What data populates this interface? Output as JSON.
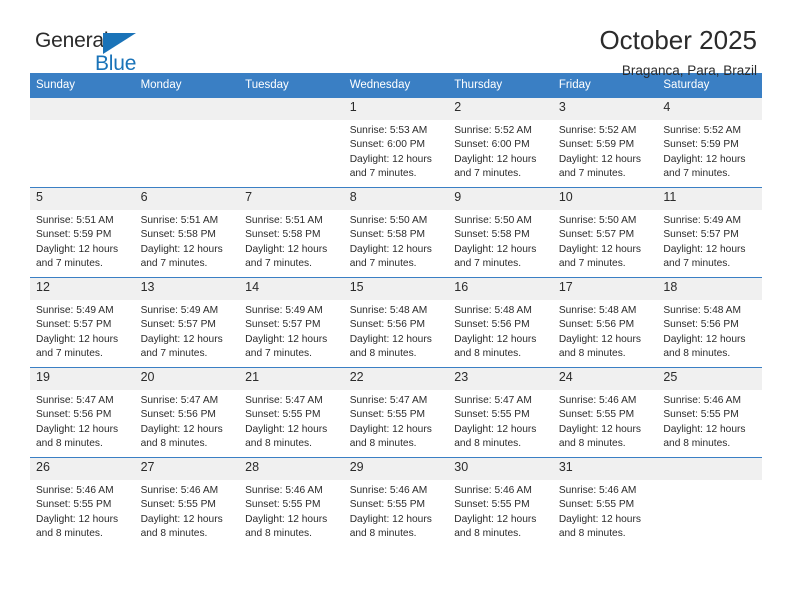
{
  "brand": {
    "word1": "General",
    "word2": "Blue",
    "triangle_color": "#1a73b8"
  },
  "header": {
    "title": "October 2025",
    "subtitle": "Braganca, Para, Brazil"
  },
  "theme": {
    "header_blue": "#3a7fc4",
    "daynum_bg": "#f0f0f0",
    "text": "#2b2b2b"
  },
  "weekdays": [
    "Sunday",
    "Monday",
    "Tuesday",
    "Wednesday",
    "Thursday",
    "Friday",
    "Saturday"
  ],
  "weeks": [
    [
      {
        "day": "",
        "sunrise": "",
        "sunset": "",
        "daylight1": "",
        "daylight2": ""
      },
      {
        "day": "",
        "sunrise": "",
        "sunset": "",
        "daylight1": "",
        "daylight2": ""
      },
      {
        "day": "",
        "sunrise": "",
        "sunset": "",
        "daylight1": "",
        "daylight2": ""
      },
      {
        "day": "1",
        "sunrise": "Sunrise: 5:53 AM",
        "sunset": "Sunset: 6:00 PM",
        "daylight1": "Daylight: 12 hours",
        "daylight2": "and 7 minutes."
      },
      {
        "day": "2",
        "sunrise": "Sunrise: 5:52 AM",
        "sunset": "Sunset: 6:00 PM",
        "daylight1": "Daylight: 12 hours",
        "daylight2": "and 7 minutes."
      },
      {
        "day": "3",
        "sunrise": "Sunrise: 5:52 AM",
        "sunset": "Sunset: 5:59 PM",
        "daylight1": "Daylight: 12 hours",
        "daylight2": "and 7 minutes."
      },
      {
        "day": "4",
        "sunrise": "Sunrise: 5:52 AM",
        "sunset": "Sunset: 5:59 PM",
        "daylight1": "Daylight: 12 hours",
        "daylight2": "and 7 minutes."
      }
    ],
    [
      {
        "day": "5",
        "sunrise": "Sunrise: 5:51 AM",
        "sunset": "Sunset: 5:59 PM",
        "daylight1": "Daylight: 12 hours",
        "daylight2": "and 7 minutes."
      },
      {
        "day": "6",
        "sunrise": "Sunrise: 5:51 AM",
        "sunset": "Sunset: 5:58 PM",
        "daylight1": "Daylight: 12 hours",
        "daylight2": "and 7 minutes."
      },
      {
        "day": "7",
        "sunrise": "Sunrise: 5:51 AM",
        "sunset": "Sunset: 5:58 PM",
        "daylight1": "Daylight: 12 hours",
        "daylight2": "and 7 minutes."
      },
      {
        "day": "8",
        "sunrise": "Sunrise: 5:50 AM",
        "sunset": "Sunset: 5:58 PM",
        "daylight1": "Daylight: 12 hours",
        "daylight2": "and 7 minutes."
      },
      {
        "day": "9",
        "sunrise": "Sunrise: 5:50 AM",
        "sunset": "Sunset: 5:58 PM",
        "daylight1": "Daylight: 12 hours",
        "daylight2": "and 7 minutes."
      },
      {
        "day": "10",
        "sunrise": "Sunrise: 5:50 AM",
        "sunset": "Sunset: 5:57 PM",
        "daylight1": "Daylight: 12 hours",
        "daylight2": "and 7 minutes."
      },
      {
        "day": "11",
        "sunrise": "Sunrise: 5:49 AM",
        "sunset": "Sunset: 5:57 PM",
        "daylight1": "Daylight: 12 hours",
        "daylight2": "and 7 minutes."
      }
    ],
    [
      {
        "day": "12",
        "sunrise": "Sunrise: 5:49 AM",
        "sunset": "Sunset: 5:57 PM",
        "daylight1": "Daylight: 12 hours",
        "daylight2": "and 7 minutes."
      },
      {
        "day": "13",
        "sunrise": "Sunrise: 5:49 AM",
        "sunset": "Sunset: 5:57 PM",
        "daylight1": "Daylight: 12 hours",
        "daylight2": "and 7 minutes."
      },
      {
        "day": "14",
        "sunrise": "Sunrise: 5:49 AM",
        "sunset": "Sunset: 5:57 PM",
        "daylight1": "Daylight: 12 hours",
        "daylight2": "and 7 minutes."
      },
      {
        "day": "15",
        "sunrise": "Sunrise: 5:48 AM",
        "sunset": "Sunset: 5:56 PM",
        "daylight1": "Daylight: 12 hours",
        "daylight2": "and 8 minutes."
      },
      {
        "day": "16",
        "sunrise": "Sunrise: 5:48 AM",
        "sunset": "Sunset: 5:56 PM",
        "daylight1": "Daylight: 12 hours",
        "daylight2": "and 8 minutes."
      },
      {
        "day": "17",
        "sunrise": "Sunrise: 5:48 AM",
        "sunset": "Sunset: 5:56 PM",
        "daylight1": "Daylight: 12 hours",
        "daylight2": "and 8 minutes."
      },
      {
        "day": "18",
        "sunrise": "Sunrise: 5:48 AM",
        "sunset": "Sunset: 5:56 PM",
        "daylight1": "Daylight: 12 hours",
        "daylight2": "and 8 minutes."
      }
    ],
    [
      {
        "day": "19",
        "sunrise": "Sunrise: 5:47 AM",
        "sunset": "Sunset: 5:56 PM",
        "daylight1": "Daylight: 12 hours",
        "daylight2": "and 8 minutes."
      },
      {
        "day": "20",
        "sunrise": "Sunrise: 5:47 AM",
        "sunset": "Sunset: 5:56 PM",
        "daylight1": "Daylight: 12 hours",
        "daylight2": "and 8 minutes."
      },
      {
        "day": "21",
        "sunrise": "Sunrise: 5:47 AM",
        "sunset": "Sunset: 5:55 PM",
        "daylight1": "Daylight: 12 hours",
        "daylight2": "and 8 minutes."
      },
      {
        "day": "22",
        "sunrise": "Sunrise: 5:47 AM",
        "sunset": "Sunset: 5:55 PM",
        "daylight1": "Daylight: 12 hours",
        "daylight2": "and 8 minutes."
      },
      {
        "day": "23",
        "sunrise": "Sunrise: 5:47 AM",
        "sunset": "Sunset: 5:55 PM",
        "daylight1": "Daylight: 12 hours",
        "daylight2": "and 8 minutes."
      },
      {
        "day": "24",
        "sunrise": "Sunrise: 5:46 AM",
        "sunset": "Sunset: 5:55 PM",
        "daylight1": "Daylight: 12 hours",
        "daylight2": "and 8 minutes."
      },
      {
        "day": "25",
        "sunrise": "Sunrise: 5:46 AM",
        "sunset": "Sunset: 5:55 PM",
        "daylight1": "Daylight: 12 hours",
        "daylight2": "and 8 minutes."
      }
    ],
    [
      {
        "day": "26",
        "sunrise": "Sunrise: 5:46 AM",
        "sunset": "Sunset: 5:55 PM",
        "daylight1": "Daylight: 12 hours",
        "daylight2": "and 8 minutes."
      },
      {
        "day": "27",
        "sunrise": "Sunrise: 5:46 AM",
        "sunset": "Sunset: 5:55 PM",
        "daylight1": "Daylight: 12 hours",
        "daylight2": "and 8 minutes."
      },
      {
        "day": "28",
        "sunrise": "Sunrise: 5:46 AM",
        "sunset": "Sunset: 5:55 PM",
        "daylight1": "Daylight: 12 hours",
        "daylight2": "and 8 minutes."
      },
      {
        "day": "29",
        "sunrise": "Sunrise: 5:46 AM",
        "sunset": "Sunset: 5:55 PM",
        "daylight1": "Daylight: 12 hours",
        "daylight2": "and 8 minutes."
      },
      {
        "day": "30",
        "sunrise": "Sunrise: 5:46 AM",
        "sunset": "Sunset: 5:55 PM",
        "daylight1": "Daylight: 12 hours",
        "daylight2": "and 8 minutes."
      },
      {
        "day": "31",
        "sunrise": "Sunrise: 5:46 AM",
        "sunset": "Sunset: 5:55 PM",
        "daylight1": "Daylight: 12 hours",
        "daylight2": "and 8 minutes."
      },
      {
        "day": "",
        "sunrise": "",
        "sunset": "",
        "daylight1": "",
        "daylight2": ""
      }
    ]
  ]
}
